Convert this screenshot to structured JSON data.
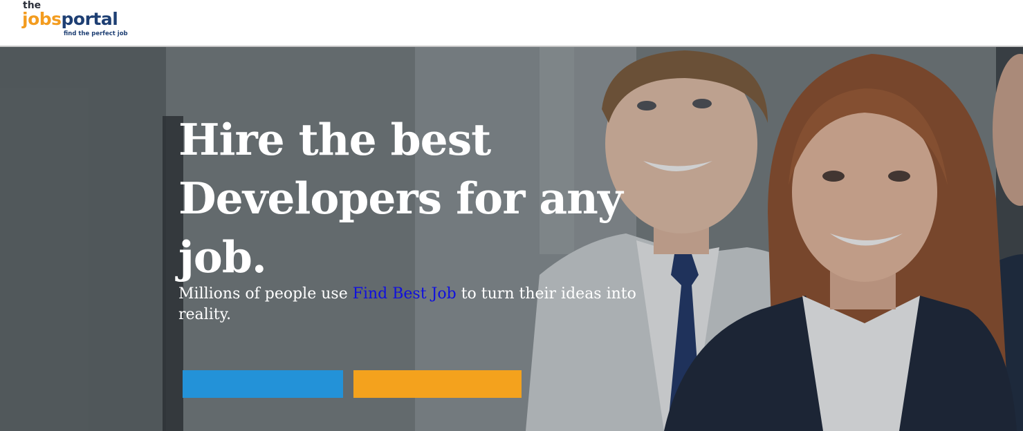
{
  "header": {
    "logo": {
      "the": "the",
      "jobs": "jobs",
      "portal": "portal",
      "tagline": "find the perfect job"
    }
  },
  "hero": {
    "headline": "Hire the best Developers for any job.",
    "subtitle_before": "Millions of people use ",
    "subtitle_brand": "Find Best Job",
    "subtitle_after": " to turn their ideas into reality.",
    "buttons": {
      "primary_label": "",
      "secondary_label": ""
    }
  },
  "colors": {
    "logo_orange": "#f39c1f",
    "logo_navy": "#1e3f73",
    "brand_link": "#1010dd",
    "button_blue": "#2392d8",
    "button_orange": "#f4a21d"
  }
}
